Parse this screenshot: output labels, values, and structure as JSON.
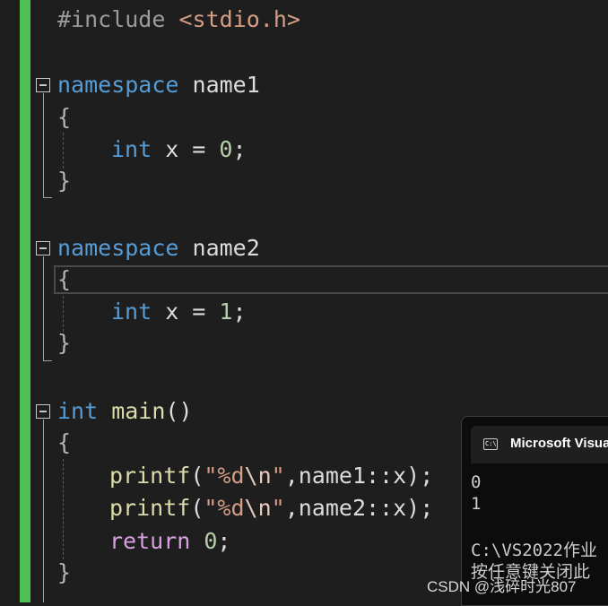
{
  "editor": {
    "lines": {
      "include_directive": "#include",
      "include_file": "<stdio.h>",
      "ns1_keyword": "namespace",
      "ns1_name": " name1",
      "ns1_open": "{",
      "ns1_body_type": "int",
      "ns1_body_rest": " x = ",
      "ns1_body_value": "0",
      "ns1_body_end": ";",
      "ns1_close": "}",
      "ns2_keyword": "namespace",
      "ns2_name": " name2",
      "ns2_open": "{",
      "ns2_body_type": "int",
      "ns2_body_rest": " x = ",
      "ns2_body_value": "1",
      "ns2_body_end": ";",
      "ns2_close": "}",
      "main_type": "int",
      "main_name": " main",
      "main_parens": "()",
      "main_open": "{",
      "printf1_fn": "printf",
      "printf1_paren": "(",
      "printf1_str_a": "\"%d",
      "printf1_esc": "\\n",
      "printf1_str_b": "\"",
      "printf1_rest": ",name1::x);",
      "printf2_fn": "printf",
      "printf2_paren": "(",
      "printf2_str_a": "\"%d",
      "printf2_esc": "\\n",
      "printf2_str_b": "\"",
      "printf2_rest": ",name2::x);",
      "return_kw": "return",
      "return_value": " 0",
      "return_end": ";",
      "main_close": "}"
    }
  },
  "terminal": {
    "title": "Microsoft Visua",
    "icon_label": "C:\\",
    "output": [
      "0",
      "1",
      "",
      "C:\\VS2022作业",
      "按任意键关闭此"
    ]
  },
  "watermark": "CSDN @浅碎时光807",
  "colors": {
    "background": "#1e1e1e",
    "change_bar": "#4ec053",
    "keyword": "#569cd6",
    "function": "#dcdcaa",
    "number": "#b5cea8",
    "string": "#d69d85"
  }
}
